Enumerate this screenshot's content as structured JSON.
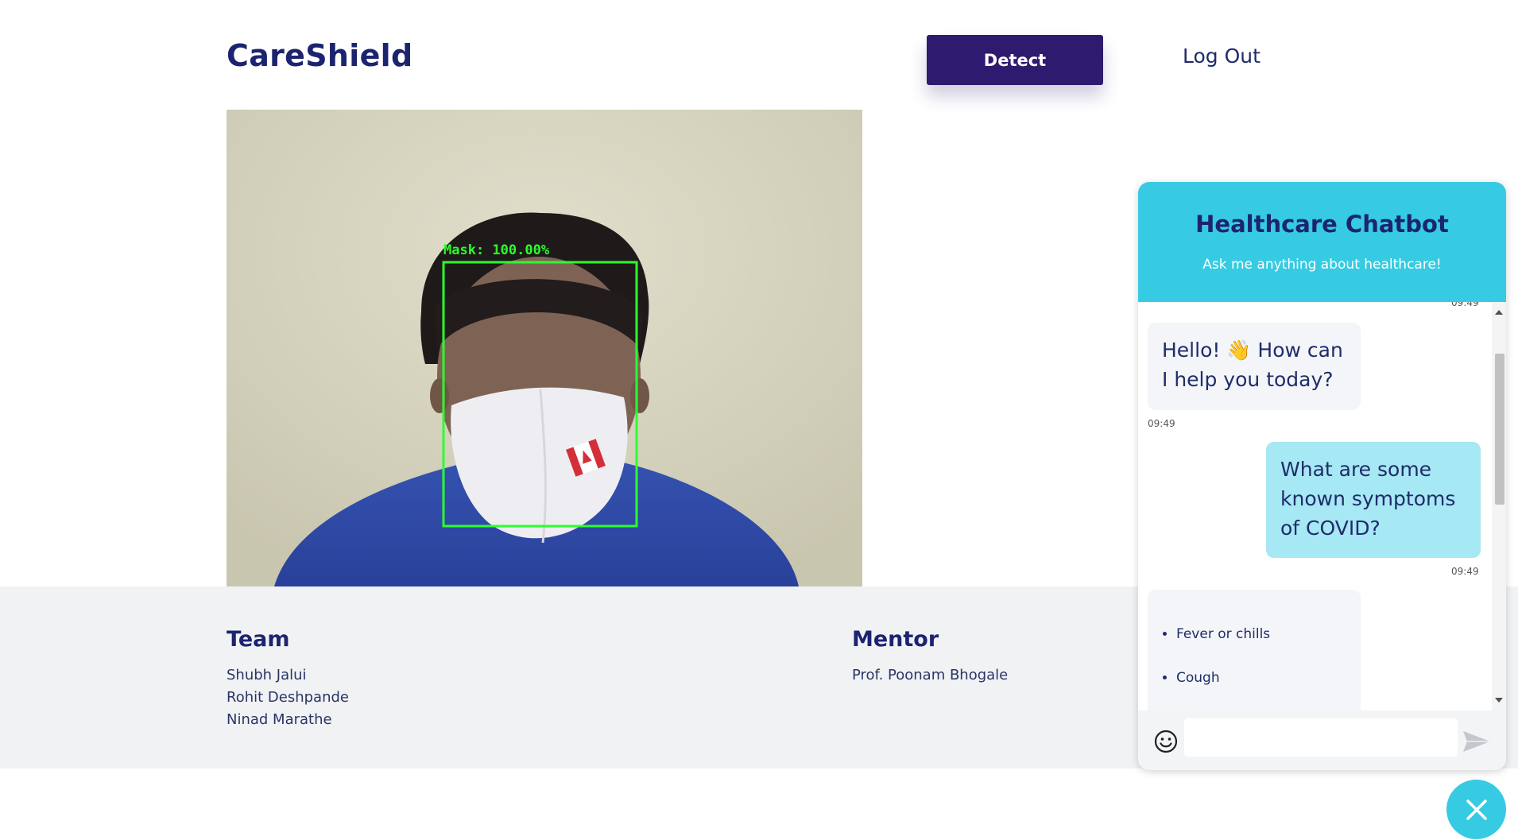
{
  "header": {
    "brand": "CareShield",
    "detect_label": "Detect",
    "logout_label": "Log Out"
  },
  "camera": {
    "detection_label": "Mask: 100.00%"
  },
  "footer": {
    "team_title": "Team",
    "team_members": [
      "Shubh Jalui",
      "Rohit Deshpande",
      "Ninad Marathe"
    ],
    "mentor_title": "Mentor",
    "mentors": [
      "Prof. Poonam Bhogale"
    ]
  },
  "chatbot": {
    "title": "Healthcare Chatbot",
    "subtitle": "Ask me anything about healthcare!",
    "top_timestamp": "09:49",
    "messages": [
      {
        "from": "bot",
        "lines": [
          "Hello! 👋 How can",
          "I help you today?"
        ],
        "time": "09:49"
      },
      {
        "from": "user",
        "lines": [
          "What are some",
          "known symptoms",
          "of COVID?"
        ],
        "time": "09:49"
      }
    ],
    "list_message": {
      "items": [
        "Fever or chills",
        "Cough"
      ]
    },
    "input_placeholder": "",
    "icons": {
      "emoji": "smiley-icon",
      "send": "send-icon",
      "close": "close-icon"
    }
  },
  "colors": {
    "brand": "#1c2470",
    "detect_button": "#2e1a6e",
    "chat_header": "#36cbe2",
    "user_bubble": "#a6e8f3",
    "bot_bubble": "#f3f5f8",
    "footer_bg": "#f1f2f4",
    "detection_box": "#2cff2c"
  }
}
